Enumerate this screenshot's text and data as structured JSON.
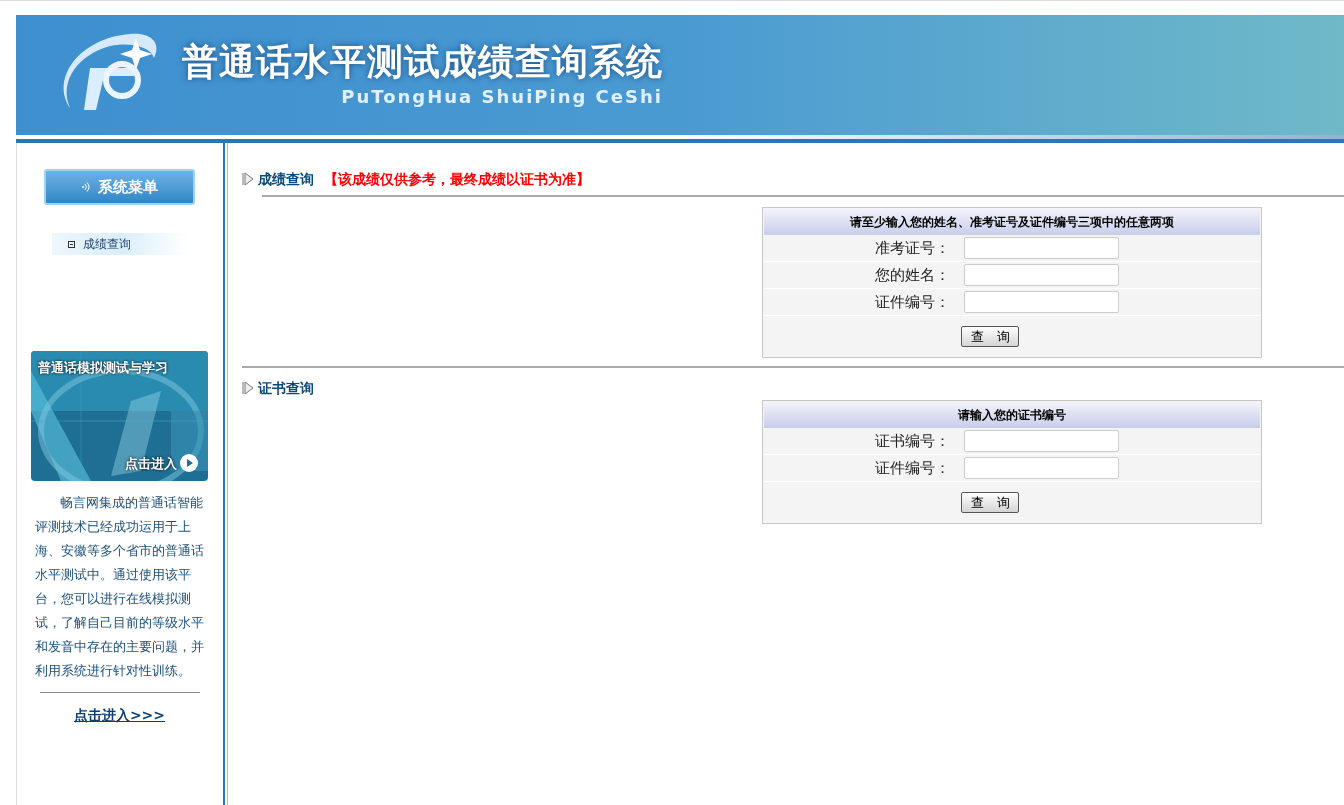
{
  "header": {
    "title": "普通话水平测试成绩查询系统",
    "subtitle": "PuTongHua ShuiPing CeShi"
  },
  "sidebar": {
    "menu_title": "系统菜单",
    "items": [
      {
        "label": "成绩查询"
      }
    ],
    "promo": {
      "kind": "picture",
      "title": "普通话模拟测试与学习",
      "action": "点击进入"
    },
    "description": "畅言网集成的普通话智能评测技术已经成功运用于上海、安徽等多个省市的普通话水平测试中。通过使用该平台，您可以进行在线模拟测试，了解自己目前的等级水平和发音中存在的主要问题，并利用系统进行针对性训练。",
    "link": "点击进入>>>"
  },
  "sections": [
    {
      "title": "成绩查询",
      "notice": "【该成绩仅供参考，最终成绩以证书为准】",
      "form": {
        "heading": "请至少输入您的姓名、准考证号及证件编号三项中的任意两项",
        "fields": [
          {
            "label": "准考证号："
          },
          {
            "label": "您的姓名："
          },
          {
            "label": "证件编号："
          }
        ],
        "button": "查　询"
      }
    },
    {
      "title": "证书查询",
      "form": {
        "heading": "请输入您的证书编号",
        "fields": [
          {
            "label": "证书编号："
          },
          {
            "label": "证件编号："
          }
        ],
        "button": "查　询"
      }
    }
  ]
}
